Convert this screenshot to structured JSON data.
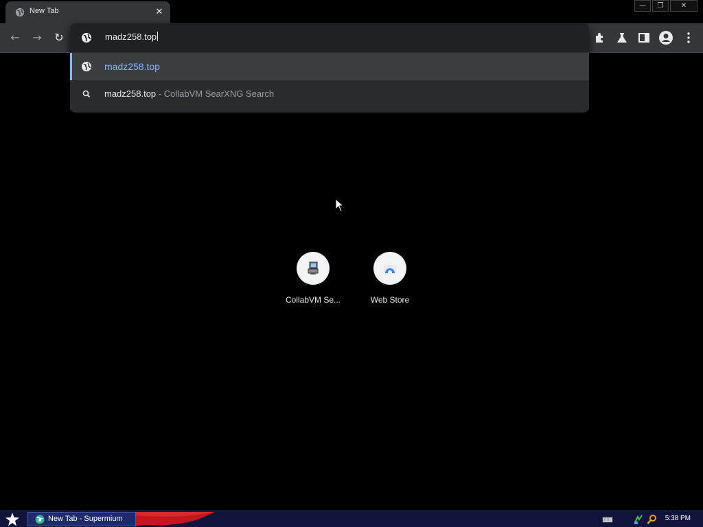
{
  "browser": {
    "tab_title": "New Tab",
    "tab_close_glyph": "✕",
    "window_buttons": {
      "minimize": "—",
      "restore": "❐",
      "close": "✕"
    }
  },
  "toolbar": {
    "back_glyph": "←",
    "forward_glyph": "→",
    "reload_glyph": "↻",
    "icons": [
      "extensions-icon",
      "flask-icon",
      "side-panel-icon",
      "profile-icon",
      "menu-icon"
    ]
  },
  "omnibox": {
    "input_value": "madz258.top",
    "suggestions": [
      {
        "icon": "globe-icon",
        "text": "madz258.top",
        "description": ""
      },
      {
        "icon": "search-icon",
        "text": "madz258.top",
        "description": " - CollabVM SearXNG Search"
      }
    ],
    "accent": "#8ab4f8"
  },
  "shortcuts": [
    {
      "label": "CollabVM Se...",
      "icon": "collabvm-icon"
    },
    {
      "label": "Web Store",
      "icon": "webstore-icon"
    }
  ],
  "taskbar": {
    "task_label": "New Tab - Supermium",
    "clock": "5:38 PM",
    "tray_icons": [
      "keyboard-icon",
      "network-icon",
      "search-icon"
    ]
  }
}
